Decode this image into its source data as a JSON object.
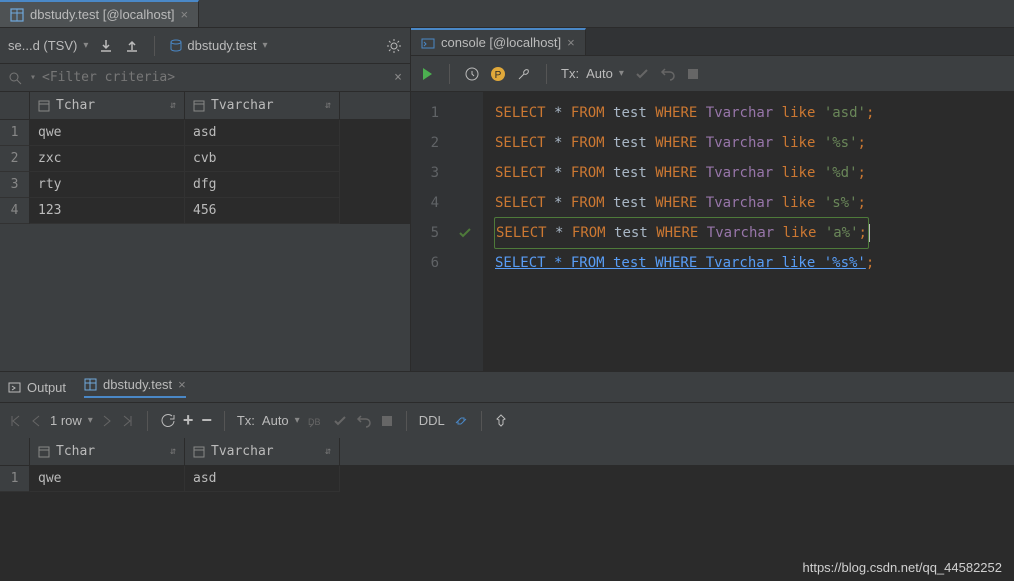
{
  "tabs": {
    "left": "dbstudy.test [@localhost]",
    "right": "console [@localhost]"
  },
  "left_toolbar": {
    "format": "se...d (TSV)",
    "schema": "dbstudy.test"
  },
  "filter_placeholder": "<Filter criteria>",
  "columns": {
    "c1": "Tchar",
    "c2": "Tvarchar"
  },
  "rows": [
    {
      "n": "1",
      "c1": "qwe",
      "c2": "asd"
    },
    {
      "n": "2",
      "c1": "zxc",
      "c2": "cvb"
    },
    {
      "n": "3",
      "c1": "rty",
      "c2": "dfg"
    },
    {
      "n": "4",
      "c1": "123",
      "c2": "456"
    }
  ],
  "tx_label": "Tx:",
  "tx_mode": "Auto",
  "sql": {
    "select": "SELECT",
    "star": "*",
    "from": "FROM",
    "tbl": "test",
    "where": "WHERE",
    "col": "Tvarchar",
    "like": "like",
    "v1": "'asd'",
    "v2": "'%s'",
    "v3": "'%d'",
    "v4": "'s%'",
    "v5": "'a%'",
    "line6": "SELECT * FROM test WHERE Tvarchar like '%s%'",
    "semi": ";"
  },
  "output_tab": "Output",
  "bottom_table_tab": "dbstudy.test",
  "pager": "1 row",
  "ddl": "DDL",
  "result_row": {
    "n": "1",
    "c1": "qwe",
    "c2": "asd"
  },
  "watermark": "https://blog.csdn.net/qq_44582252"
}
